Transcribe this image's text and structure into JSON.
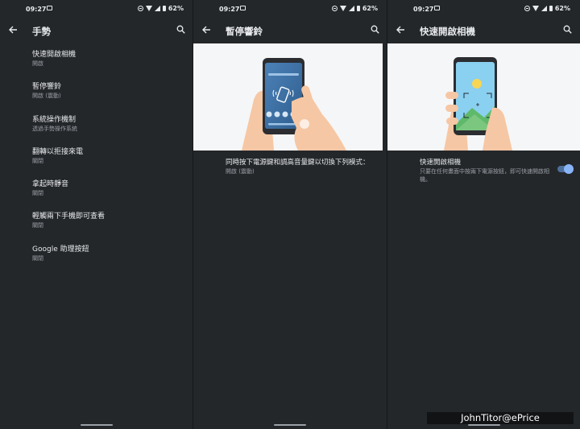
{
  "status_bar": {
    "time": "09:27",
    "battery": "62%"
  },
  "panels": [
    {
      "title": "手勢",
      "items": [
        {
          "title": "快速開啟相機",
          "subtitle": "開啟"
        },
        {
          "title": "暫停響鈴",
          "subtitle": "開啟 (震動)"
        },
        {
          "title": "系統操作機制",
          "subtitle": "透過手勢操作系統"
        },
        {
          "title": "翻轉以拒接來電",
          "subtitle": "關閉"
        },
        {
          "title": "拿起時靜音",
          "subtitle": "關閉"
        },
        {
          "title": "輕觸兩下手機即可查看",
          "subtitle": "關閉"
        },
        {
          "title": "Google 助理按鈕",
          "subtitle": "關閉"
        }
      ]
    },
    {
      "title": "暫停響鈴",
      "setting": {
        "title": "同時按下電源鍵和調高音量鍵以切換下列模式：",
        "subtitle": "開啟 (震動)"
      }
    },
    {
      "title": "快速開啟相機",
      "setting": {
        "title": "快速開啟相機",
        "subtitle": "只要在任何畫面中按兩下電源按鈕，即可快速開啟相機。",
        "enabled": true
      }
    }
  ],
  "watermark": "JohnTitor@ePrice",
  "colors": {
    "background": "#24272a",
    "accent": "#8ab4f8",
    "illustration_bg": "#f5f6f7"
  }
}
